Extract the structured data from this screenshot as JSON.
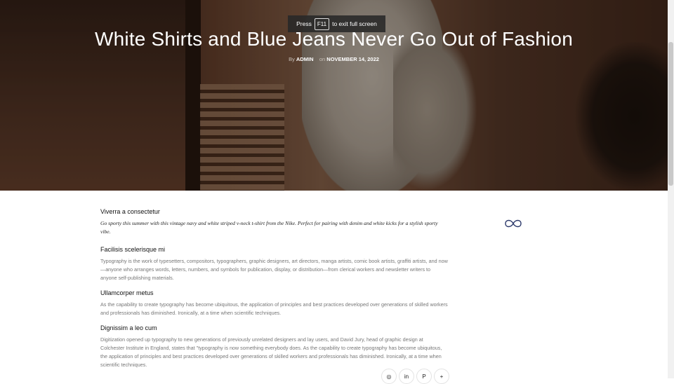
{
  "toast": {
    "prefix": "Press",
    "key": "F11",
    "suffix": "to exit full screen"
  },
  "post": {
    "title": "White Shirts and Blue Jeans Never Go Out of Fashion",
    "by_label": "By",
    "author": "ADMIN",
    "on_label": "on",
    "date": "NOVEMBER 14, 2022"
  },
  "sections": [
    {
      "heading": "Viverra a consectetur",
      "text": "Go sporty this summer with this vintage navy and white striped v-neck t-shirt from the Nike. Perfect for pairing with denim and white kicks for a stylish sporty vibe."
    },
    {
      "heading": "Facilisis scelerisque mi",
      "text": "Typography is the work of typesetters, compositors, typographers, graphic designers, art directors, manga artists, comic book artists, graffiti artists, and now—anyone who arranges words, letters, numbers, and symbols for publication, display, or distribution—from clerical workers and newsletter writers to anyone self-publishing materials."
    },
    {
      "heading": "Ullamcorper metus",
      "text": "As the capability to create typography has become ubiquitous, the application of principles and best practices developed over generations of skilled workers and professionals has diminished. Ironically, at a time when scientific techniques."
    },
    {
      "heading": "Dignissim a leo cum",
      "text": "Digitization opened up typography to new generations of previously unrelated designers and lay users, and David Jury, head of graphic design at Colchester Institute in England, states that \"typography is now something everybody does. As the capability to create typography has become ubiquitous, the application of principles and best practices developed over generations of skilled workers and professionals has diminished. Ironically, at a time when scientific techniques."
    }
  ],
  "share": [
    {
      "icon": "instagram-icon",
      "glyph": "◎"
    },
    {
      "icon": "linkedin-icon",
      "glyph": "in"
    },
    {
      "icon": "pinterest-icon",
      "glyph": "P"
    },
    {
      "icon": "plus-icon",
      "glyph": "+"
    }
  ]
}
